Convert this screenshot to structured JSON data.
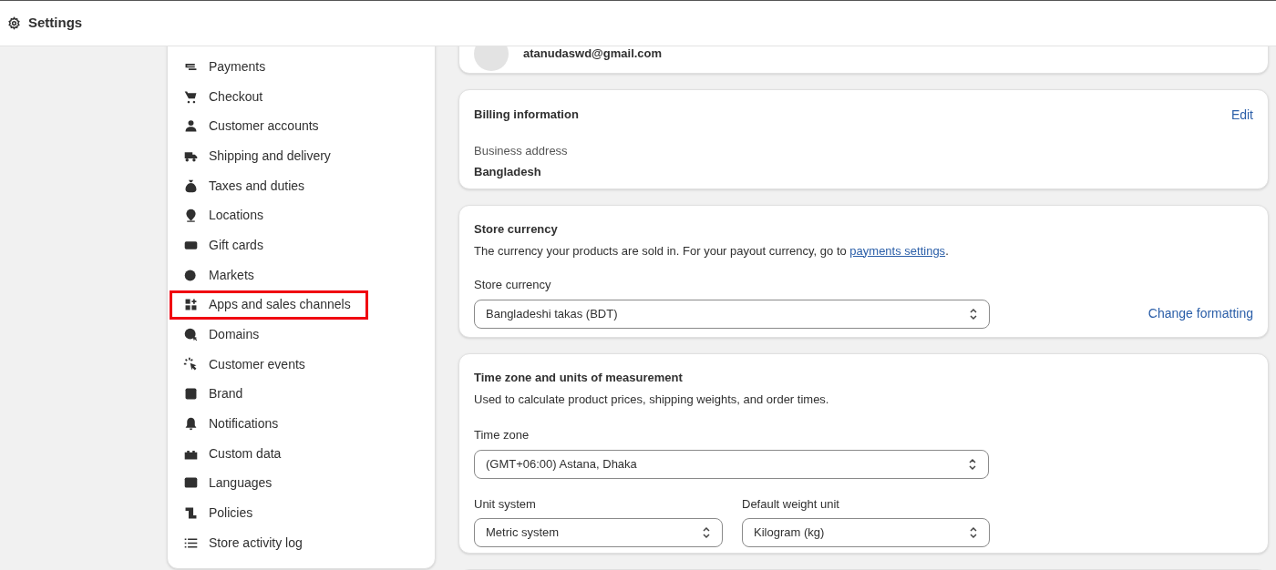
{
  "header": {
    "title": "Settings"
  },
  "sidebar": {
    "items": [
      {
        "label": "Payments",
        "highlighted": false
      },
      {
        "label": "Checkout",
        "highlighted": false
      },
      {
        "label": "Customer accounts",
        "highlighted": false
      },
      {
        "label": "Shipping and delivery",
        "highlighted": false
      },
      {
        "label": "Taxes and duties",
        "highlighted": false
      },
      {
        "label": "Locations",
        "highlighted": false
      },
      {
        "label": "Gift cards",
        "highlighted": false
      },
      {
        "label": "Markets",
        "highlighted": false
      },
      {
        "label": "Apps and sales channels",
        "highlighted": true
      },
      {
        "label": "Domains",
        "highlighted": false
      },
      {
        "label": "Customer events",
        "highlighted": false
      },
      {
        "label": "Brand",
        "highlighted": false
      },
      {
        "label": "Notifications",
        "highlighted": false
      },
      {
        "label": "Custom data",
        "highlighted": false
      },
      {
        "label": "Languages",
        "highlighted": false
      },
      {
        "label": "Policies",
        "highlighted": false
      },
      {
        "label": "Store activity log",
        "highlighted": false
      }
    ]
  },
  "account": {
    "email": "atanudaswd@gmail.com"
  },
  "billing": {
    "title": "Billing information",
    "edit": "Edit",
    "address_label": "Business address",
    "address": "Bangladesh"
  },
  "store_currency": {
    "title": "Store currency",
    "description_before": "The currency your products are sold in. For your payout currency, go to ",
    "link": "payments settings",
    "description_after": ".",
    "field_label": "Store currency",
    "value": "Bangladeshi takas (BDT)",
    "action": "Change formatting"
  },
  "time_zone": {
    "title": "Time zone and units of measurement",
    "description": "Used to calculate product prices, shipping weights, and order times.",
    "zone_label": "Time zone",
    "zone_value": "(GMT+06:00) Astana, Dhaka",
    "unit_label": "Unit system",
    "unit_value": "Metric system",
    "weight_label": "Default weight unit",
    "weight_value": "Kilogram (kg)"
  }
}
